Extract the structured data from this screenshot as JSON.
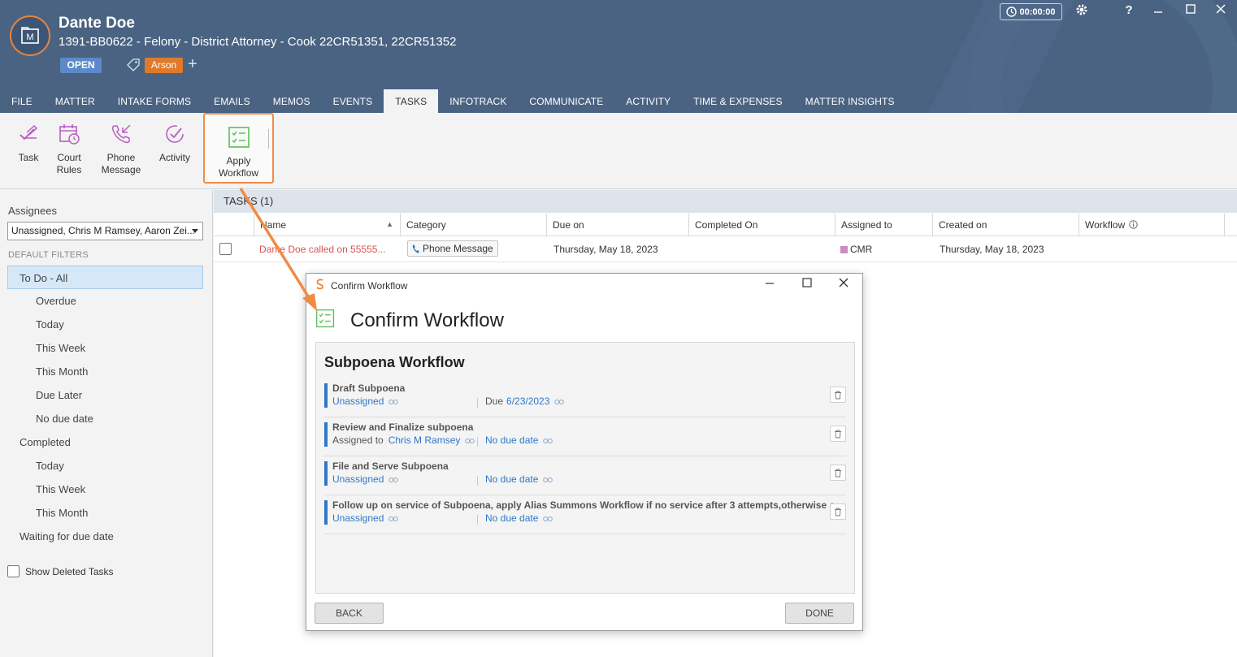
{
  "header": {
    "client_name": "Dante Doe",
    "matter_line": "1391-BB0622 - Felony - District Attorney - Cook 22CR51351, 22CR51352",
    "status_badge": "OPEN",
    "tag": "Arson",
    "add_tag": "+",
    "timer": "00:00:00",
    "help": "?",
    "colors": {
      "background": "#4a6382",
      "open_badge": "#5b8ac9",
      "tag": "#e07a2a",
      "logo_ring": "#e8853d"
    }
  },
  "tabs": [
    {
      "label": "FILE",
      "active": false
    },
    {
      "label": "MATTER",
      "active": false
    },
    {
      "label": "INTAKE FORMS",
      "active": false
    },
    {
      "label": "EMAILS",
      "active": false
    },
    {
      "label": "MEMOS",
      "active": false
    },
    {
      "label": "EVENTS",
      "active": false
    },
    {
      "label": "TASKS",
      "active": true
    },
    {
      "label": "INFOTRACK",
      "active": false
    },
    {
      "label": "COMMUNICATE",
      "active": false
    },
    {
      "label": "ACTIVITY",
      "active": false
    },
    {
      "label": "TIME & EXPENSES",
      "active": false
    },
    {
      "label": "MATTER INSIGHTS",
      "active": false
    }
  ],
  "ribbon": {
    "task": "Task",
    "court_rules": [
      "Court",
      "Rules"
    ],
    "phone_message": [
      "Phone",
      "Message"
    ],
    "activity": "Activity",
    "apply_workflow": [
      "Apply",
      "Workflow"
    ],
    "icon_color": "#b85fc4",
    "workflow_icon_color": "#5bbf5b"
  },
  "sidebar": {
    "assignees_label": "Assignees",
    "assignees_value": "Unassigned, Chris M Ramsey, Aaron Zei...",
    "default_filters_label": "DEFAULT FILTERS",
    "filters": [
      {
        "label": "To Do - All",
        "selected": true
      },
      {
        "label": "Overdue"
      },
      {
        "label": "Today"
      },
      {
        "label": "This Week"
      },
      {
        "label": "This Month"
      },
      {
        "label": "Due Later"
      },
      {
        "label": "No due date"
      },
      {
        "label": "Completed"
      },
      {
        "label": "Today"
      },
      {
        "label": "This Week"
      },
      {
        "label": "This Month"
      },
      {
        "label": "Waiting for due date"
      }
    ],
    "show_deleted": "Show Deleted Tasks"
  },
  "tasks": {
    "header": "TASKS (1)",
    "columns": [
      "Name",
      "Category",
      "Due on",
      "Completed On",
      "Assigned to",
      "Created on",
      "Workflow"
    ],
    "rows": [
      {
        "name": "Dante Doe called on 55555...",
        "category": "Phone Message",
        "due_on": "Thursday, May 18, 2023",
        "completed_on": "",
        "assigned_to": "CMR",
        "created_on": "Thursday, May 18, 2023",
        "workflow": ""
      }
    ],
    "overdue_color": "#d9534f"
  },
  "dialog": {
    "window_title": "Confirm Workflow",
    "heading": "Confirm Workflow",
    "workflow_name": "Subpoena Workflow",
    "items": [
      {
        "title": "Draft Subpoena",
        "assign_prefix": "",
        "assignee": "Unassigned",
        "due_prefix": "Due",
        "due": "6/23/2023"
      },
      {
        "title": "Review and Finalize subpoena",
        "assign_prefix": "Assigned to",
        "assignee": "Chris M Ramsey",
        "due_prefix": "",
        "due": "No due date"
      },
      {
        "title": "File and Serve Subpoena",
        "assign_prefix": "",
        "assignee": "Unassigned",
        "due_prefix": "",
        "due": "No due date"
      },
      {
        "title": "Follow up on service of Subpoena, apply Alias Summons Workflow if no service after 3 attempts,otherwise a",
        "assign_prefix": "",
        "assignee": "Unassigned",
        "due_prefix": "",
        "due": "No due date"
      }
    ],
    "back_label": "BACK",
    "done_label": "DONE",
    "accent": "#2e78c8"
  },
  "annotation": {
    "arrow_color": "#f08b46"
  }
}
